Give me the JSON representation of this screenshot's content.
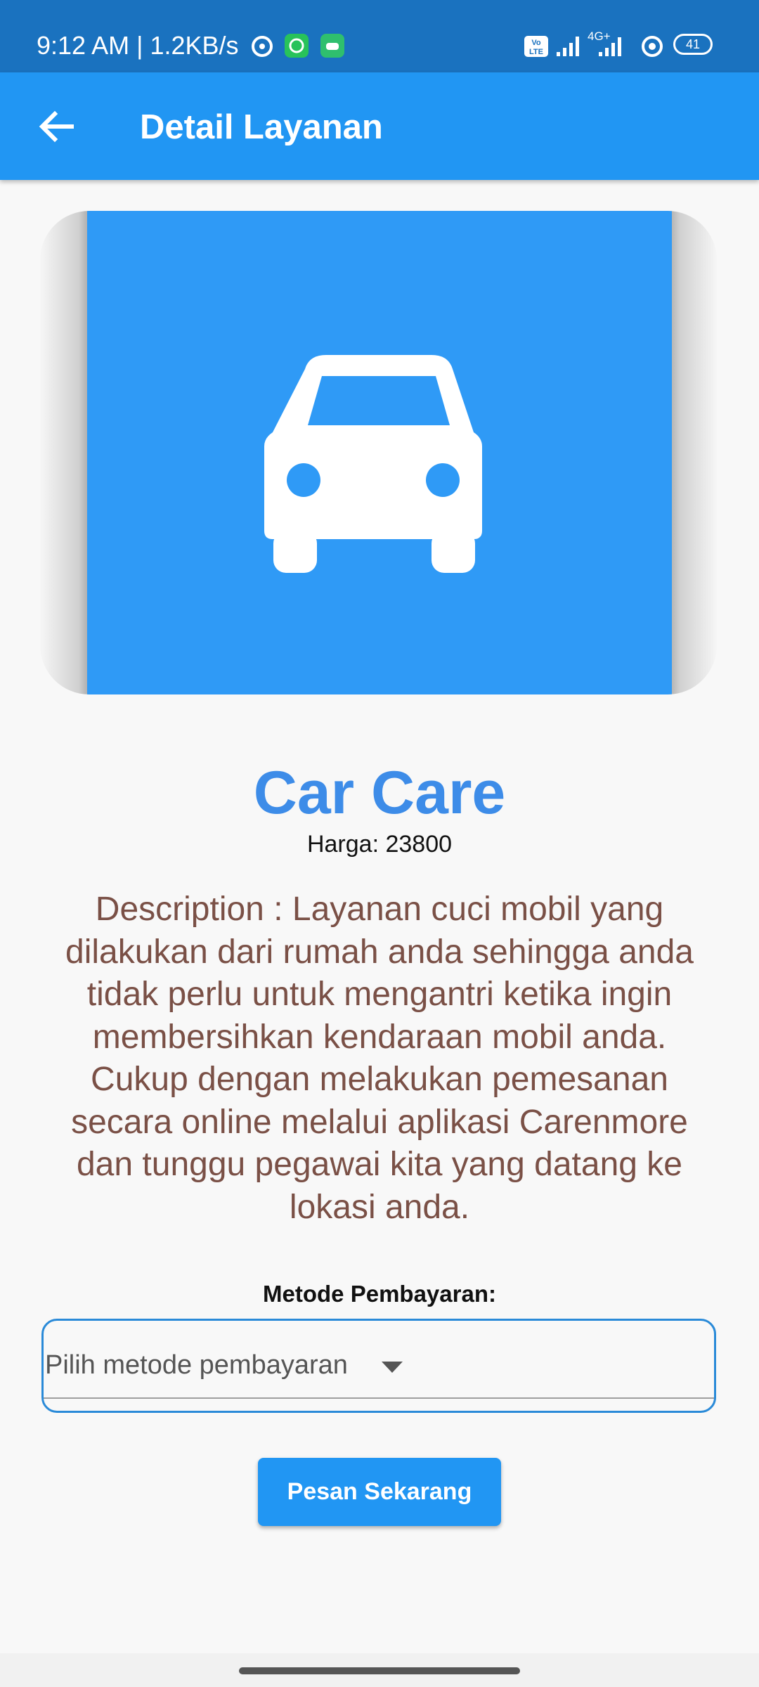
{
  "status_bar": {
    "time": "9:12 AM | 1.2KB/s",
    "network_type": "4G+",
    "volte": "Vo LTE",
    "battery": "41"
  },
  "app_bar": {
    "title": "Detail Layanan",
    "back_icon": "arrow-left-icon"
  },
  "service": {
    "image_icon": "car-icon",
    "image_bg_color": "#2f9af6",
    "title": "Car Care",
    "title_color": "#3d8ce8",
    "price": "Harga: 23800",
    "description": "Description : Layanan cuci mobil yang dilakukan dari rumah anda sehingga anda tidak perlu untuk mengantri ketika ingin membersihkan kendaraan mobil anda. Cukup dengan melakukan pemesanan secara online melalui aplikasi Carenmore dan tunggu pegawai kita yang datang ke lokasi anda.",
    "description_color": "#7a5046"
  },
  "payment": {
    "label": "Metode Pembayaran:",
    "dropdown_placeholder": "Pilih metode pembayaran"
  },
  "actions": {
    "order_button": "Pesan Sekarang"
  },
  "colors": {
    "primary": "#2196f3",
    "status_bar": "#1a72bf"
  }
}
